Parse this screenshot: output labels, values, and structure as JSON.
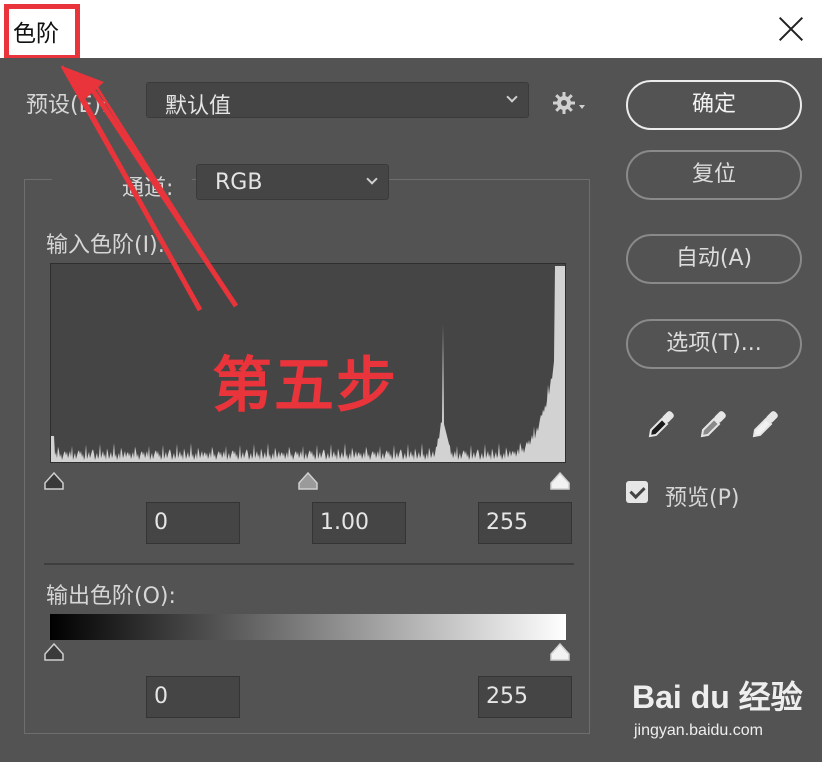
{
  "window": {
    "title": "色阶"
  },
  "preset": {
    "label": "预设(E):",
    "value": "默认值"
  },
  "channel": {
    "label": "通道:",
    "value": "RGB"
  },
  "input_levels": {
    "label": "输入色阶(I):",
    "black": "0",
    "gamma": "1.00",
    "white": "255"
  },
  "output_levels": {
    "label": "输出色阶(O):",
    "black": "0",
    "white": "255"
  },
  "buttons": {
    "ok": "确定",
    "reset": "复位",
    "auto": "自动(A)",
    "options": "选项(T)..."
  },
  "preview": {
    "label": "预览(P)",
    "checked": true
  },
  "annotation": {
    "text": "第五步",
    "color": "#e8343a"
  },
  "watermark": {
    "logo_text": "Bai du 经验",
    "url": "jingyan.baidu.com"
  },
  "colors": {
    "dialog_bg": "#535353",
    "field_bg": "#454545",
    "accent": "#e8343a"
  },
  "icons": [
    "close-icon",
    "gear-icon",
    "chevron-down-icon",
    "eyedropper-black-icon",
    "eyedropper-gray-icon",
    "eyedropper-white-icon",
    "checkbox-checked-icon"
  ]
}
